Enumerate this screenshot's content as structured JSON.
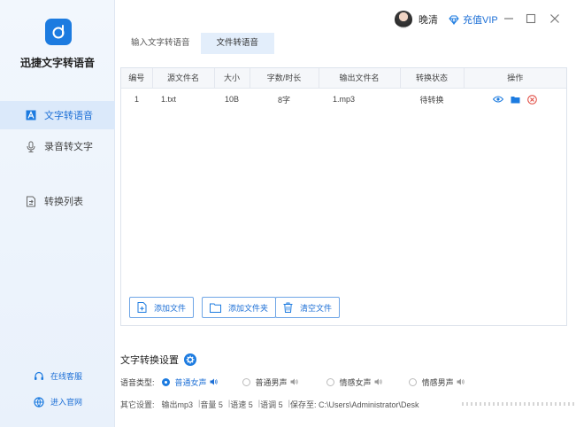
{
  "app": {
    "name": "迅捷文字转语音"
  },
  "sidebar": {
    "items": [
      {
        "label": "文字转语音",
        "active": true,
        "icon": "text-a-icon"
      },
      {
        "label": "录音转文字",
        "active": false,
        "icon": "microphone-icon"
      },
      {
        "label": "转换列表",
        "active": false,
        "icon": "convert-list-icon"
      }
    ],
    "footer": [
      {
        "label": "在线客服",
        "icon": "headset-icon"
      },
      {
        "label": "进入官网",
        "icon": "globe-icon"
      }
    ]
  },
  "topbar": {
    "username": "晚清",
    "vip_label": "充值VIP"
  },
  "tabs": [
    {
      "label": "输入文字转语音",
      "active": false
    },
    {
      "label": "文件转语音",
      "active": true
    }
  ],
  "table": {
    "headers": [
      "编号",
      "源文件名",
      "大小",
      "字数/时长",
      "输出文件名",
      "转换状态",
      "操作"
    ],
    "rows": [
      {
        "id": "1",
        "source": "1.txt",
        "size": "10B",
        "count": "8字",
        "output": "1.mp3",
        "status": "待转换"
      }
    ]
  },
  "buttons": {
    "add_file": "添加文件",
    "add_folder": "添加文件夹",
    "clear_files": "清空文件"
  },
  "settings": {
    "title": "文字转换设置",
    "voice_type_label": "语音类型:",
    "voices": [
      {
        "label": "普通女声",
        "selected": true
      },
      {
        "label": "普通男声",
        "selected": false
      },
      {
        "label": "情感女声",
        "selected": false
      },
      {
        "label": "情感男声",
        "selected": false
      }
    ],
    "other_label": "其它设置:",
    "other": [
      "输出mp3",
      "音量 5",
      "语速 5",
      "语调 5",
      "保存至: C:\\Users\\Administrator\\Desk"
    ]
  },
  "colors": {
    "accent": "#1c7be0",
    "link": "#1c6fd6",
    "close": "#e0463c"
  }
}
